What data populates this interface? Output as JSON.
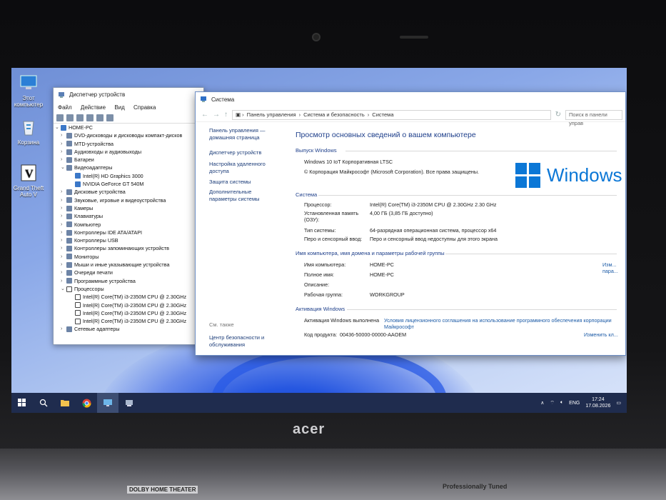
{
  "desktop": {
    "icons": [
      {
        "label": "Этот компьютер",
        "icon": "computer-icon"
      },
      {
        "label": "Корзина",
        "icon": "recycle-bin-icon"
      },
      {
        "label": "Grand Theft Auto V",
        "icon": "gta-icon"
      }
    ]
  },
  "device_manager": {
    "title": "Диспетчер устройств",
    "menu": [
      "Файл",
      "Действие",
      "Вид",
      "Справка"
    ],
    "root": "HOME-PC",
    "items": [
      {
        "label": "DVD-дисководы и дисководы компакт-дисков",
        "expanded": false
      },
      {
        "label": "MTD-устройства",
        "expanded": false
      },
      {
        "label": "Аудиовходы и аудиовыходы",
        "expanded": false
      },
      {
        "label": "Батареи",
        "expanded": false
      },
      {
        "label": "Видеоадаптеры",
        "expanded": true
      },
      {
        "label": "Intel(R) HD Graphics 3000",
        "child": true
      },
      {
        "label": "NVIDIA GeForce GT 540M",
        "child": true
      },
      {
        "label": "Дисковые устройства",
        "expanded": false
      },
      {
        "label": "Звуковые, игровые и видеоустройства",
        "expanded": false
      },
      {
        "label": "Камеры",
        "expanded": false
      },
      {
        "label": "Клавиатуры",
        "expanded": false
      },
      {
        "label": "Компьютер",
        "expanded": false
      },
      {
        "label": "Контроллеры IDE ATA/ATAPI",
        "expanded": false
      },
      {
        "label": "Контроллеры USB",
        "expanded": false
      },
      {
        "label": "Контроллеры запоминающих устройств",
        "expanded": false
      },
      {
        "label": "Мониторы",
        "expanded": false
      },
      {
        "label": "Мыши и иные указывающие устройства",
        "expanded": false
      },
      {
        "label": "Очереди печати",
        "expanded": false
      },
      {
        "label": "Программные устройства",
        "expanded": false
      },
      {
        "label": "Процессоры",
        "expanded": true
      },
      {
        "label": "Intel(R) Core(TM) i3-2350M CPU @ 2.30GHz",
        "child": true
      },
      {
        "label": "Intel(R) Core(TM) i3-2350M CPU @ 2.30GHz",
        "child": true
      },
      {
        "label": "Intel(R) Core(TM) i3-2350M CPU @ 2.30GHz",
        "child": true
      },
      {
        "label": "Intel(R) Core(TM) i3-2350M CPU @ 2.30GHz",
        "child": true
      },
      {
        "label": "Сетевые адаптеры",
        "expanded": false
      }
    ]
  },
  "system": {
    "title": "Система",
    "breadcrumb": [
      "Панель управления",
      "Система и безопасность",
      "Система"
    ],
    "search_placeholder": "Поиск в панели управ",
    "left_links": [
      "Панель управления — домашняя страница",
      "Диспетчер устройств",
      "Настройка удаленного доступа",
      "Защита системы",
      "Дополнительные параметры системы"
    ],
    "see_also": "См. также",
    "security_link": "Центр безопасности и обслуживания",
    "heading": "Просмотр основных сведений о вашем компьютере",
    "edition_section": "Выпуск Windows",
    "edition": "Windows 10 IoT Корпоративная LTSC",
    "copyright": "© Корпорация Майкрософт (Microsoft Corporation). Все права защищены.",
    "logo_text": "Windows",
    "system_section": "Система",
    "processor_label": "Процессор:",
    "processor_value": "Intel(R) Core(TM) i3-2350M CPU @ 2.30GHz   2.30 GHz",
    "ram_label": "Установленная память (ОЗУ):",
    "ram_value": "4,00 ГБ (3,85 ГБ доступно)",
    "type_label": "Тип системы:",
    "type_value": "64-разрядная операционная система, процессор x64",
    "pen_label": "Перо и сенсорный ввод:",
    "pen_value": "Перо и сенсорный ввод недоступны для этого экрана",
    "name_section": "Имя компьютера, имя домена и параметры рабочей группы",
    "comp_label": "Имя компьютера:",
    "comp_value": "HOME-PC",
    "full_label": "Полное имя:",
    "full_value": "HOME-PC",
    "desc_label": "Описание:",
    "desc_value": "",
    "wg_label": "Рабочая группа:",
    "wg_value": "WORKGROUP",
    "change_params": "Изм... пара...",
    "activation_section": "Активация Windows",
    "activation_status": "Активация Windows выполнена",
    "license_link": "Условия лицензионного соглашения на использование программного обеспечения корпорации Майкрософт",
    "product_label": "Код продукта:",
    "product_value": "00436-50000-00000-AAOEM",
    "change_key": "Изменить кл..."
  },
  "taskbar": {
    "lang": "ENG",
    "time": "17:24",
    "date": "17.08.2026"
  },
  "laptop": {
    "brand": "acer",
    "dolby": "DOLBY HOME THEATER",
    "tuned": "Professionally Tuned"
  }
}
